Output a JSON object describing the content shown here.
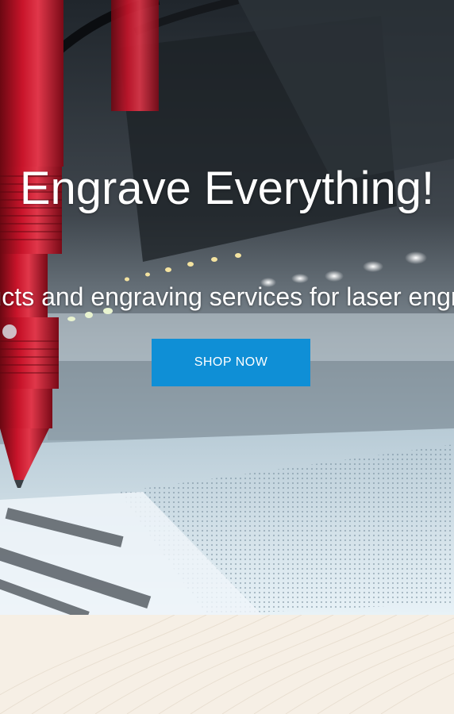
{
  "hero": {
    "title": "Engrave Everything!",
    "subtitle": "Products and engraving services for laser engraving",
    "cta_label": "SHOP NOW"
  },
  "colors": {
    "cta_background": "#0f8fd6",
    "lower_background": "#f6efe5",
    "text": "#ffffff"
  }
}
